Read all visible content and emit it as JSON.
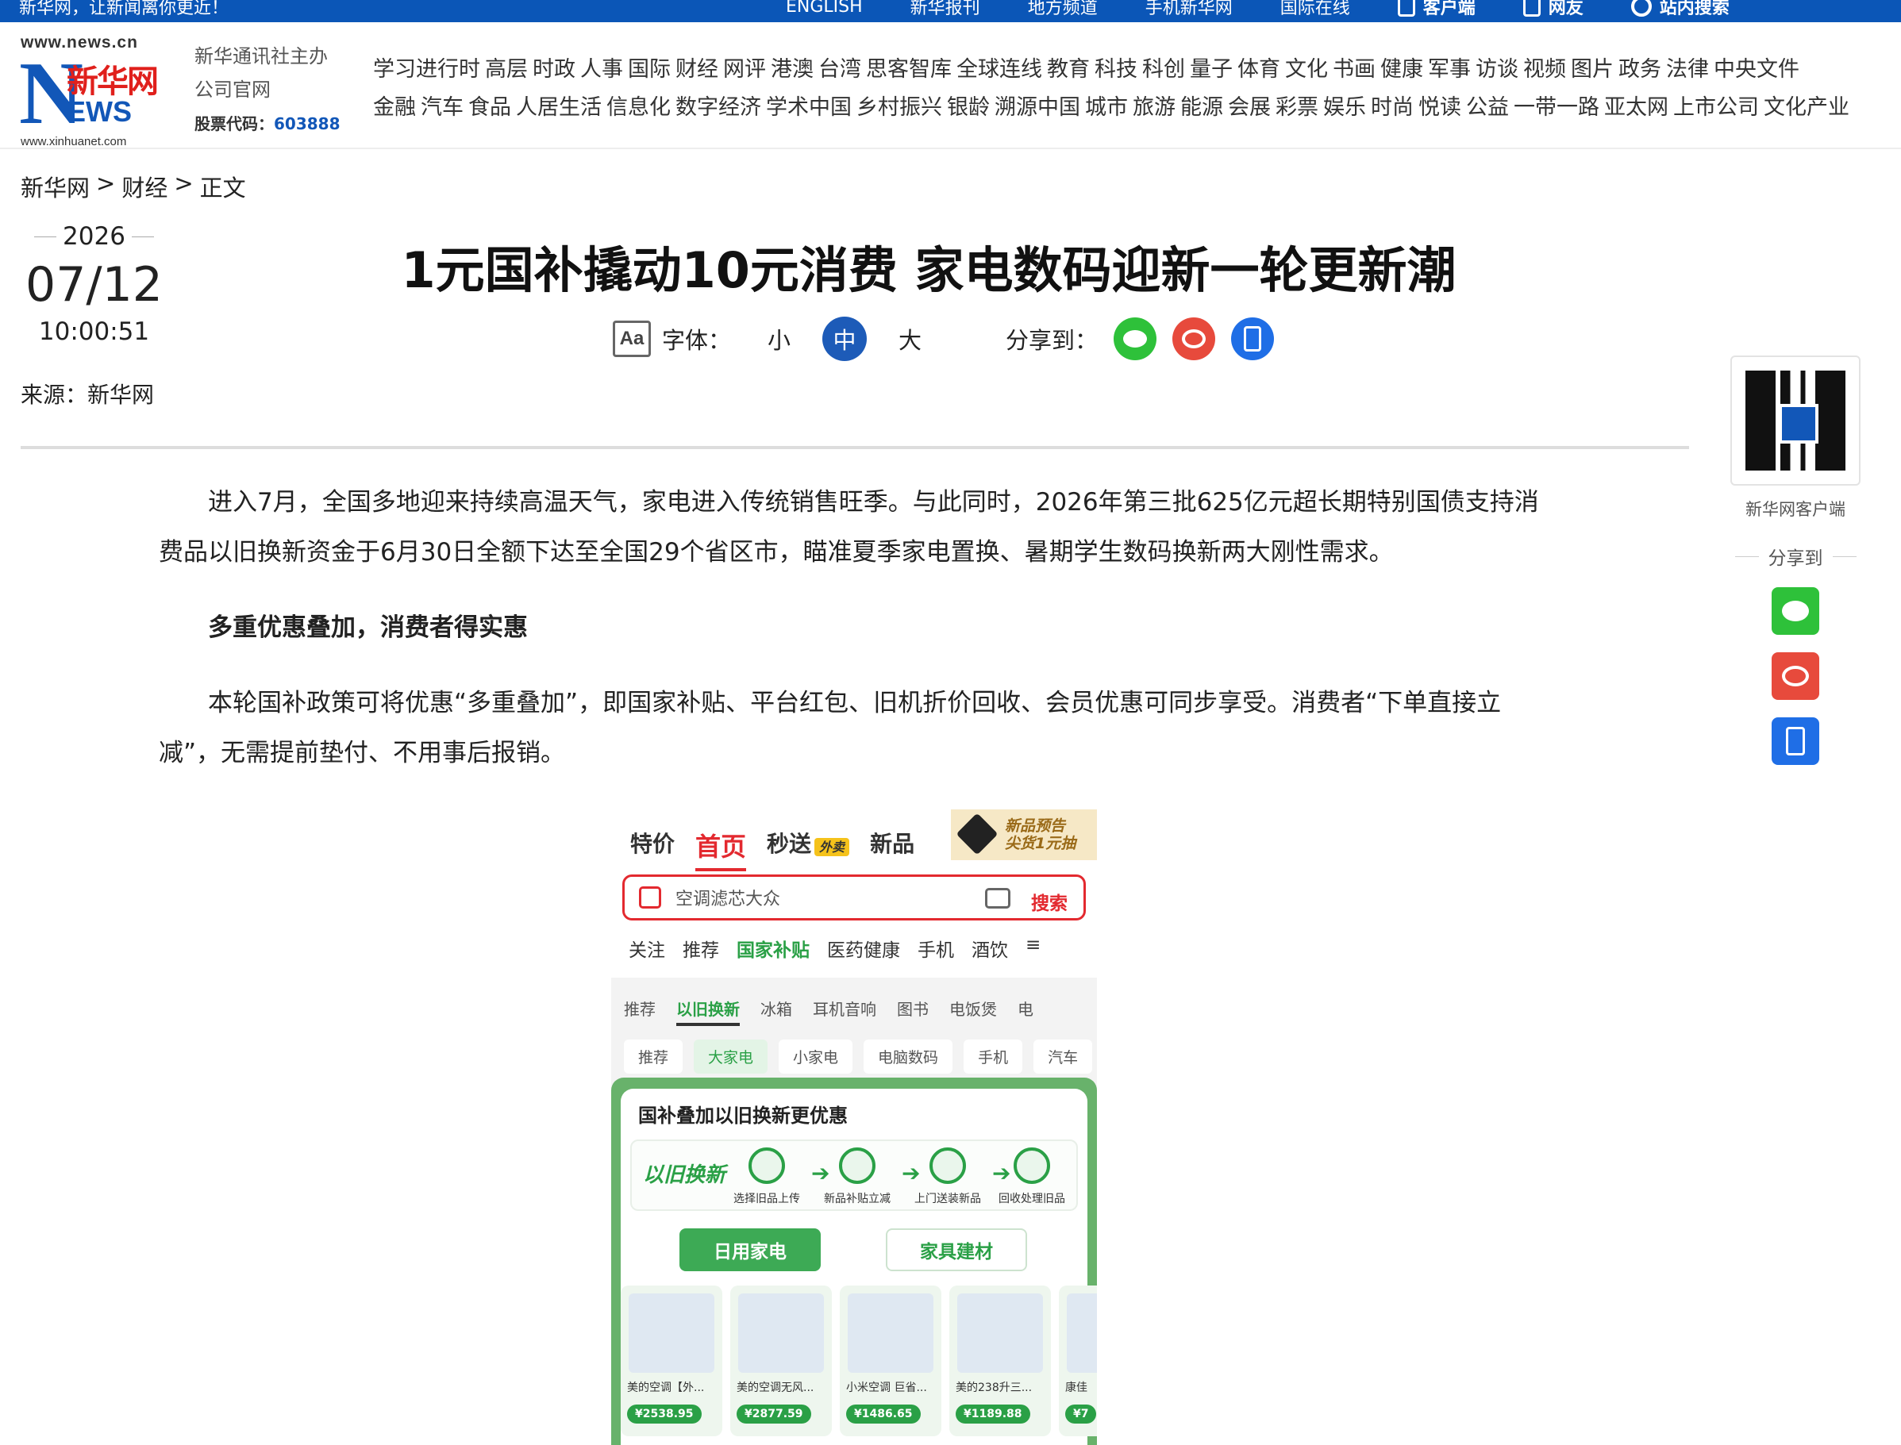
{
  "topbar": {
    "slogan": "新华网，让新闻离你更近！",
    "links": [
      "ENGLISH",
      "新华报刊",
      "地方频道",
      "手机新华网",
      "国际在线",
      "客户端",
      "网友"
    ],
    "search_label": "站内搜索"
  },
  "header": {
    "logo_url": "www.news.cn",
    "logo_cn": "新华网",
    "logo_url_bottom": "www.xinhuanet.com",
    "org_line1": "新华通讯社主办",
    "org_line2": "公司官网",
    "stock_label": "股票代码：",
    "stock_code": "603888",
    "channels_row1": [
      "学习进行时",
      "高层",
      "时政",
      "人事",
      "国际",
      "财经",
      "网评",
      "港澳",
      "台湾",
      "思客智库",
      "全球连线",
      "教育",
      "科技",
      "科创",
      "量子",
      "体育",
      "文化",
      "书画",
      "健康",
      "军事",
      "访谈",
      "视频",
      "图片",
      "政务",
      "法律",
      "中央文件"
    ],
    "channels_row2": [
      "金融",
      "汽车",
      "食品",
      "人居生活",
      "信息化",
      "数字经济",
      "学术中国",
      "乡村振兴",
      "银龄",
      "溯源中国",
      "城市",
      "旅游",
      "能源",
      "会展",
      "彩票",
      "娱乐",
      "时尚",
      "悦读",
      "公益",
      "一带一路",
      "亚太网",
      "上市公司",
      "文化产业"
    ]
  },
  "breadcrumb": {
    "home": "新华网",
    "sep1": ">",
    "section": "财经",
    "sep2": ">",
    "current": "正文"
  },
  "meta": {
    "year": "2026",
    "month_day": "07/12",
    "time": "10:00:51",
    "source_label": "来源：",
    "source": "新华网"
  },
  "article": {
    "title": "1元国补撬动10元消费 家电数码迎新一轮更新潮",
    "font_label": "字体：",
    "font_small": "小",
    "font_medium": "中",
    "font_large": "大",
    "share_label": "分享到：",
    "p1": "进入7月，全国多地迎来持续高温天气，家电进入传统销售旺季。与此同时，2026年第三批625亿元超长期特别国债支持消费品以旧换新资金于6月30日全额下达至全国29个省区市，瞄准夏季家电置换、暑期学生数码换新两大刚性需求。",
    "subhead": "多重优惠叠加，消费者得实惠",
    "p2": "本轮国补政策可将优惠“多重叠加”，即国家补贴、平台红包、旧机折价回收、会员优惠可同步享受。消费者“下单直接立减”，无需提前垫付、不用事后报销。"
  },
  "screenshot": {
    "tabs": [
      "特价",
      "首页",
      "秒送",
      "新品"
    ],
    "takeout_badge": "外卖",
    "promo_line1": "新品预告",
    "promo_line2": "尖货1元抽",
    "search_placeholder": "空调滤芯大众",
    "search_button": "搜索",
    "nav": [
      "关注",
      "推荐",
      "国家补贴",
      "医药健康",
      "手机",
      "酒饮",
      "≡"
    ],
    "subnav": [
      "推荐",
      "以旧换新",
      "冰箱",
      "耳机音响",
      "图书",
      "电饭煲",
      "电"
    ],
    "chips": [
      "推荐",
      "大家电",
      "小家电",
      "电脑数码",
      "手机",
      "汽车"
    ],
    "panel_title": "国补叠加以旧换新更优惠",
    "flow_brand": "以旧换新",
    "steps": [
      "选择旧品上传",
      "新品补贴立减",
      "上门送装新品",
      "回收处理旧品"
    ],
    "btn_daily": "日用家电",
    "btn_furniture": "家具建材",
    "products": [
      {
        "name": "美的空调【外...",
        "price": "¥2538.95"
      },
      {
        "name": "美的空调无风...",
        "price": "¥2877.59"
      },
      {
        "name": "小米空调 巨省...",
        "price": "¥1486.65"
      },
      {
        "name": "美的238升三...",
        "price": "¥1189.88"
      },
      {
        "name": "康佳",
        "price": "¥7"
      }
    ]
  },
  "sidebar": {
    "qr_label": "新华网客户端",
    "share_title": "分享到"
  }
}
